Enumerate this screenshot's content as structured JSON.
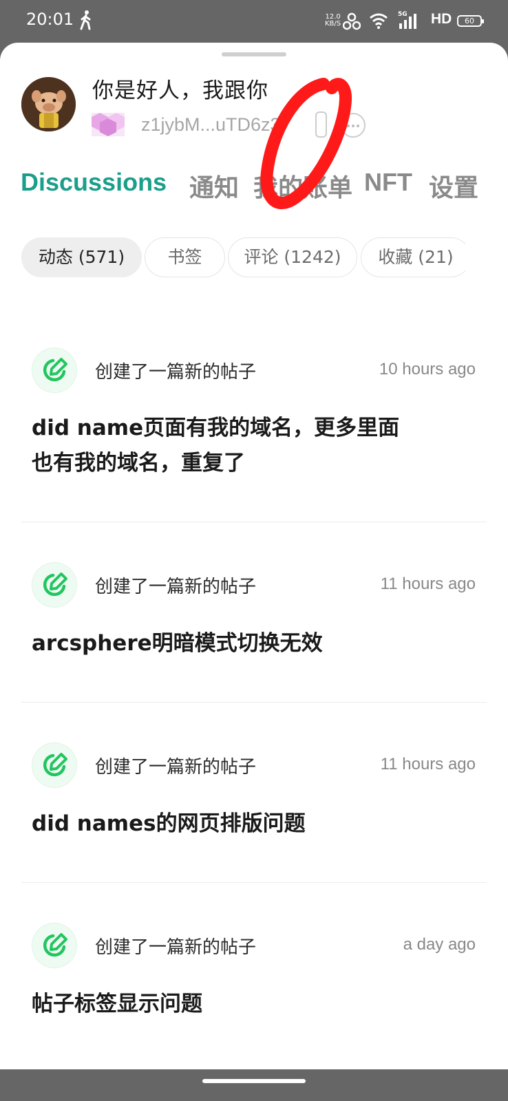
{
  "status_bar": {
    "time": "20:01",
    "net_speed_value": "12.0",
    "net_speed_unit": "KB/S",
    "network_type": "5G",
    "hd_label": "HD",
    "battery": "60",
    "icons": [
      "walk-icon",
      "link-icon",
      "wifi-icon",
      "signal-icon",
      "battery-icon"
    ]
  },
  "profile": {
    "name": "你是好人，我跟你",
    "did_address": "z1jybM...uTD6z3"
  },
  "tabs": [
    {
      "label": "Discussions",
      "active": true
    },
    {
      "label": "通知",
      "active": false
    },
    {
      "label": "我的账单",
      "active": false
    },
    {
      "label": "NFT",
      "active": false
    },
    {
      "label": "设置",
      "active": false
    }
  ],
  "filters": [
    {
      "label": "动态 (571)",
      "active": true
    },
    {
      "label": "书签",
      "active": false
    },
    {
      "label": "评论 (1242)",
      "active": false
    },
    {
      "label": "收藏 (21)",
      "active": false
    }
  ],
  "feed": [
    {
      "action": "创建了一篇新的帖子",
      "time": "10 hours ago",
      "title": "did name页面有我的域名，更多里面也有我的域名，重复了"
    },
    {
      "action": "创建了一篇新的帖子",
      "time": "11 hours ago",
      "title": "arcsphere明暗模式切换无效"
    },
    {
      "action": "创建了一篇新的帖子",
      "time": "11 hours ago",
      "title": "did names的网页排版问题"
    },
    {
      "action": "创建了一篇新的帖子",
      "time": "a day ago",
      "title": "帖子标签显示问题"
    }
  ],
  "colors": {
    "accent": "#1b9e8a",
    "icon_green": "#22c55e",
    "annotation_red": "#ff1a1a"
  }
}
